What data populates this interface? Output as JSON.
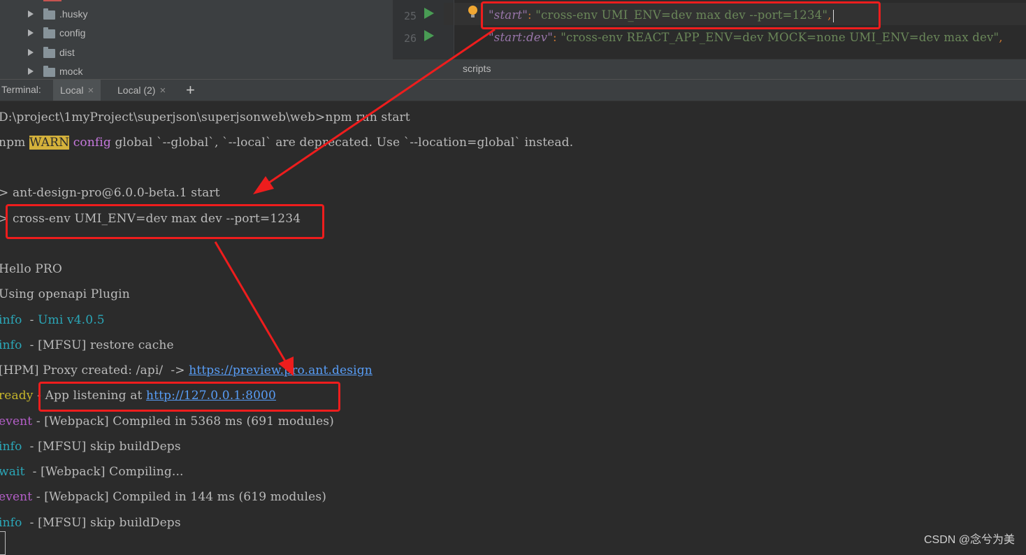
{
  "tree": {
    "items": [
      {
        "label": ".husky"
      },
      {
        "label": "config"
      },
      {
        "label": "dist"
      },
      {
        "label": "mock"
      }
    ]
  },
  "editor": {
    "line_numbers": [
      "25",
      "26"
    ],
    "line25": {
      "key": "\"start\"",
      "colon": ": ",
      "value": "\"cross-env UMI_ENV=dev max dev --port=1234\"",
      "comma": ","
    },
    "line26": {
      "key": "\"start:dev\"",
      "colon": ": ",
      "value": "\"cross-env REACT_APP_ENV=dev MOCK=none UMI_ENV=dev max dev\"",
      "comma": ","
    },
    "breadcrumb": "scripts"
  },
  "terminal": {
    "label": "Terminal:",
    "tabs": [
      {
        "label": "Local",
        "close": "×"
      },
      {
        "label": "Local (2)",
        "close": "×"
      }
    ],
    "add_label": "+",
    "lines": {
      "cmd_path": "D:\\project\\1myProject\\superjson\\superjsonweb\\web>",
      "cmd": "npm run start",
      "warn_prefix": "npm ",
      "warn_tag": "WARN",
      "warn_config": " config",
      "warn_text": " global `--global`, `--local` are deprecated. Use `--location=global` instead.",
      "pkg": "> ant-design-pro@6.0.0-beta.1 start",
      "script": "> cross-env UMI_ENV=dev max dev --port=1234",
      "hello": "Hello PRO",
      "plugin": "Using openapi Plugin",
      "info1_tag": "info",
      "info1_sep": "  - ",
      "info1_text": "Umi v4.0.5",
      "info2_tag": "info",
      "info2_text": "  - [MFSU] restore cache",
      "hpm_text": "[HPM] Proxy created: /api/  -> ",
      "hpm_link": "https://preview.pro.ant.design",
      "ready_tag": "ready",
      "ready_text": " - App listening at ",
      "ready_link": "http://127.0.0.1:8000",
      "event1_tag": "event",
      "event1_text": " - [Webpack] Compiled in 5368 ms (691 modules)",
      "info3_tag": "info",
      "info3_text": "  - [MFSU] skip buildDeps",
      "wait_tag": "wait",
      "wait_text": "  - [Webpack] Compiling...",
      "event2_tag": "event",
      "event2_text": " - [Webpack] Compiled in 144 ms (619 modules)",
      "info4_tag": "info",
      "info4_text": "  - [MFSU] skip buildDeps"
    }
  },
  "watermark": "CSDN @念兮为美",
  "colors": {
    "annotation_red": "#ee1d1d",
    "run_green": "#499c54",
    "warn_yellow": "#d4b13b",
    "link_blue": "#589df6"
  }
}
